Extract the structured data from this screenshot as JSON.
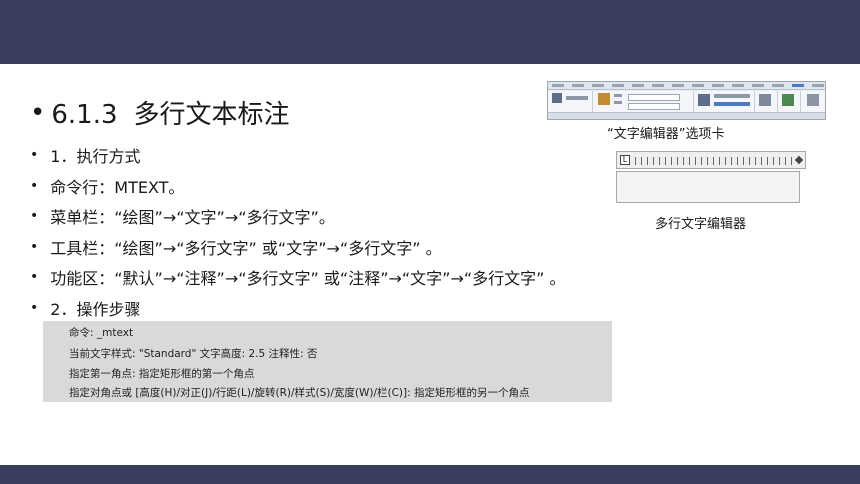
{
  "slide": {
    "section_number": "6.1.3",
    "section_title": "多行文本标注",
    "bullets": [
      "1．执行方式",
      "命令行：MTEXT。",
      "菜单栏：“绘图”→“文字”→“多行文字”。",
      "工具栏：“绘图”→“多行文字” 或“文字”→“多行文字” 。",
      "功能区：“默认”→“注释”→“多行文字” 或“注释”→“文字”→“多行文字” 。",
      "2．操作步骤"
    ],
    "command_lines": [
      "命令: _mtext",
      "当前文字样式: \"Standard\"   文字高度:   2.5   注释性:   否",
      "指定第一角点: 指定矩形框的第一个角点",
      "指定对角点或  [高度(H)/对正(J)/行距(L)/旋转(R)/样式(S)/宽度(W)/栏(C)]:  指定矩形框的另一个角点"
    ],
    "figure_captions": {
      "ribbon": "“文字编辑器”选项卡",
      "editor": "多行文字编辑器"
    }
  },
  "colors": {
    "bar": "#3c3e5e",
    "command_background": "#d9d9d9"
  }
}
